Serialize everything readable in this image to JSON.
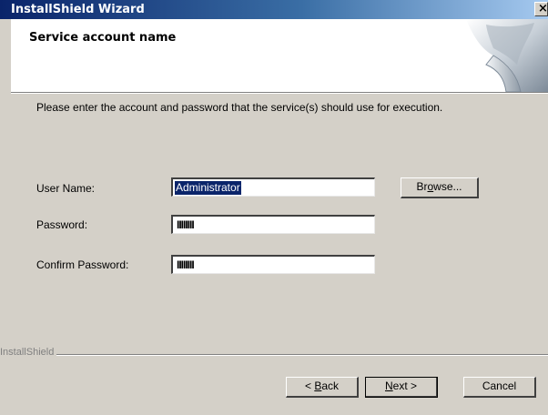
{
  "window": {
    "title": "InstallShield Wizard",
    "close_glyph": "×"
  },
  "header": {
    "title": "Service account name"
  },
  "description": "Please enter the account and password that the service(s) should use for execution.",
  "fields": {
    "username": {
      "label": "User Name:",
      "value": "Administrator"
    },
    "password": {
      "label": "Password:",
      "masked_value": "IIIIIIII"
    },
    "confirm_password": {
      "label": "Confirm Password:",
      "masked_value": "IIIIIIII"
    }
  },
  "buttons": {
    "browse": {
      "before": "Br",
      "accel": "o",
      "after": "wse..."
    },
    "back": {
      "before": "< ",
      "accel": "B",
      "after": "ack"
    },
    "next": {
      "before": "",
      "accel": "N",
      "after": "ext >"
    },
    "cancel": {
      "label": "Cancel"
    }
  },
  "footer": {
    "brand": "InstallShield"
  },
  "colors": {
    "titlebar_start": "#0a246a",
    "titlebar_end": "#a6caf0",
    "dialog_face": "#d4d0c8",
    "selection": "#0a246a"
  }
}
